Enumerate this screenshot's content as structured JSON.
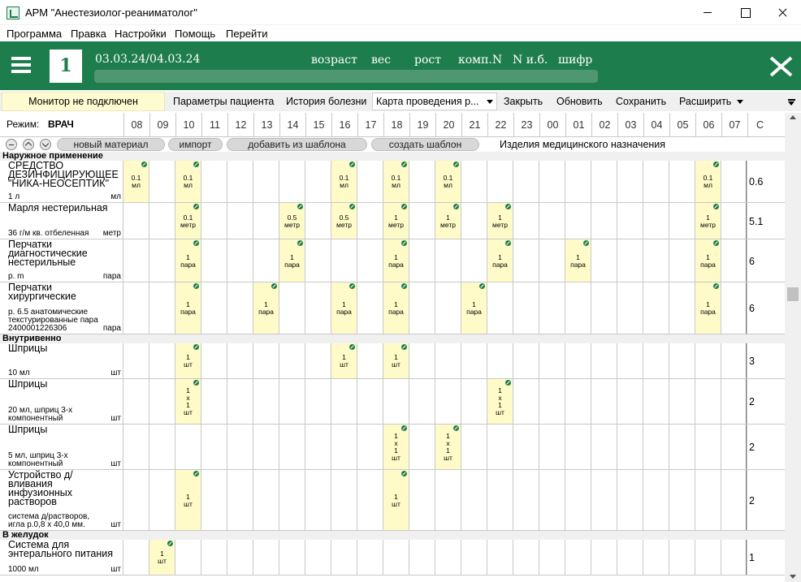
{
  "window": {
    "title": "АРМ \"Анестезиолог-реаниматолог\""
  },
  "menu": [
    "Программа",
    "Правка",
    "Настройки",
    "Помощь",
    "Перейти"
  ],
  "header": {
    "bed_number": "1",
    "dates": "03.03.24/04.03.24",
    "columns": [
      "возраст",
      "вес",
      "рост",
      "комп.N",
      "N и.б.",
      "шифр"
    ],
    "accent_color": "#1e7d4c"
  },
  "toolbar": {
    "monitor_status": "Монитор не подключен",
    "patient_params": "Параметры пациента",
    "history": "История болезни",
    "chart_dropdown": "Карта проведения р...",
    "close": "Закрыть",
    "refresh": "Обновить",
    "save": "Сохранить",
    "expand": "Расширить"
  },
  "grid": {
    "mode_label": "Режим:",
    "mode_value": "ВРАЧ",
    "hours": [
      "08",
      "09",
      "10",
      "11",
      "12",
      "13",
      "14",
      "15",
      "16",
      "17",
      "18",
      "19",
      "20",
      "21",
      "22",
      "23",
      "00",
      "01",
      "02",
      "03",
      "04",
      "05",
      "06",
      "07"
    ],
    "total_header": "С",
    "actions": {
      "new_material": "новый материал",
      "import": "импорт",
      "add_from_template": "добавить из шаблона",
      "create_template": "создать шаблон",
      "products_label": "Изделия медицинского назначения"
    },
    "sections": [
      {
        "title": "Наружное применение",
        "rows": [
          {
            "name": "СРЕДСТВО ДЕЗИНФИЦИРУЮЩЕЕ \"НИКА-НЕОСЕПТИК\"",
            "desc": "1 л",
            "unit": "мл",
            "total": "0.6",
            "cells": [
              {
                "h": 0,
                "dose": "0.1\nмл"
              },
              {
                "h": 2,
                "dose": "0.1\nмл"
              },
              {
                "h": 8,
                "dose": "0.1\nмл"
              },
              {
                "h": 10,
                "dose": "0.1\nмл"
              },
              {
                "h": 12,
                "dose": "0.1\nмл"
              },
              {
                "h": 22,
                "dose": "0.1\nмл"
              }
            ]
          },
          {
            "name": "Марля нестерильная",
            "desc": "36 г/м кв. отбеленная",
            "unit": "метр",
            "total": "5.1",
            "cells": [
              {
                "h": 2,
                "dose": "0.1\nметр"
              },
              {
                "h": 6,
                "dose": "0.5\nметр"
              },
              {
                "h": 8,
                "dose": "0.5\nметр"
              },
              {
                "h": 10,
                "dose": "1\nметр"
              },
              {
                "h": 12,
                "dose": "1\nметр"
              },
              {
                "h": 14,
                "dose": "1\nметр"
              },
              {
                "h": 22,
                "dose": "1\nметр"
              }
            ]
          },
          {
            "name": "Перчатки диагностические нестерильные",
            "desc": "р. m",
            "unit": "пара",
            "total": "6",
            "cells": [
              {
                "h": 2,
                "dose": "1\nпара"
              },
              {
                "h": 6,
                "dose": "1\nпара"
              },
              {
                "h": 10,
                "dose": "1\nпара"
              },
              {
                "h": 14,
                "dose": "1\nпара"
              },
              {
                "h": 17,
                "dose": "1\nпара"
              },
              {
                "h": 22,
                "dose": "1\nпара"
              }
            ]
          },
          {
            "name": "Перчатки хирургические",
            "desc": "р. 6.5 анатомические текстурированные пара 2400001226306",
            "unit": "пара",
            "total": "6",
            "cells": [
              {
                "h": 2,
                "dose": "1\nпара"
              },
              {
                "h": 5,
                "dose": "1\nпара"
              },
              {
                "h": 8,
                "dose": "1\nпара"
              },
              {
                "h": 10,
                "dose": "1\nпара"
              },
              {
                "h": 13,
                "dose": "1\nпара"
              },
              {
                "h": 22,
                "dose": "1\nпара"
              }
            ]
          }
        ]
      },
      {
        "title": "Внутривенно",
        "rows": [
          {
            "name": "Шприцы",
            "desc": "10 мл",
            "unit": "шт",
            "total": "3",
            "cells": [
              {
                "h": 2,
                "dose": "1\nшт"
              },
              {
                "h": 8,
                "dose": "1\nшт"
              },
              {
                "h": 10,
                "dose": "1\nшт"
              }
            ]
          },
          {
            "name": "Шприцы",
            "desc": "20 мл, шприц 3-х компонентный",
            "unit": "шт",
            "total": "2",
            "cells": [
              {
                "h": 2,
                "dose": "1\nх\n1\nшт"
              },
              {
                "h": 14,
                "dose": "1\nх\n1\nшт"
              }
            ]
          },
          {
            "name": "Шприцы",
            "desc": "5 мл, шприц 3-х компонентный",
            "unit": "шт",
            "total": "2",
            "cells": [
              {
                "h": 10,
                "dose": "1\nх\n1\nшт"
              },
              {
                "h": 12,
                "dose": "1\nх\n1\nшт"
              }
            ]
          },
          {
            "name": "Устройство д/вливания инфузионных растворов",
            "desc": "система д/растворов, игла р.0,8 х 40,0 мм.",
            "unit": "шт",
            "total": "2",
            "cells": [
              {
                "h": 2,
                "dose": "1\nшт"
              },
              {
                "h": 10,
                "dose": "1\nшт"
              }
            ]
          }
        ]
      },
      {
        "title": "В желудок",
        "rows": [
          {
            "name": "Система для энтерального питания",
            "desc": "1000 мл",
            "unit": "шт",
            "total": "1",
            "cells": [
              {
                "h": 1,
                "dose": "1\nшт"
              }
            ]
          }
        ]
      }
    ]
  }
}
